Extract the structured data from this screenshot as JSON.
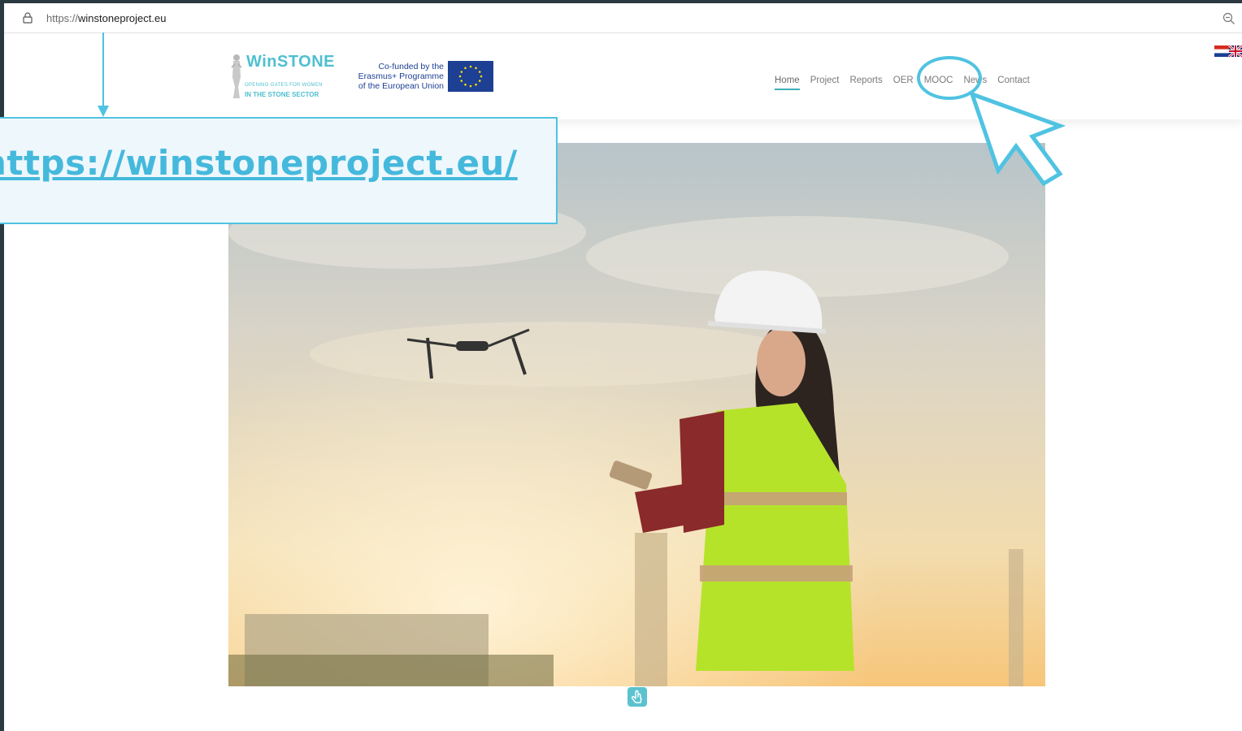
{
  "browser": {
    "url_scheme": "https://",
    "url_host": "winstoneproject.eu",
    "icons": {
      "lock": "lock-icon",
      "zoom": "zoom-out-icon"
    }
  },
  "site": {
    "logo": {
      "title": "WinSTONE",
      "subtitle_line1": "OPENING GATES FOR WOMEN",
      "subtitle_line2": "IN THE STONE SECTOR"
    },
    "eu_badge": {
      "line1": "Co-funded by the",
      "line2": "Erasmus+ Programme",
      "line3": "of the European Union"
    },
    "nav": [
      {
        "label": "Home",
        "active": true
      },
      {
        "label": "Project",
        "active": false
      },
      {
        "label": "Reports",
        "active": false
      },
      {
        "label": "OER",
        "active": false
      },
      {
        "label": "MOOC",
        "active": false
      },
      {
        "label": "News",
        "active": false
      },
      {
        "label": "Contact",
        "active": false
      }
    ],
    "language_icon": "language-flags-icon"
  },
  "overlay": {
    "callout_text": "https://winstoneproject.eu/"
  },
  "colors": {
    "accent": "#4fc3e1",
    "brand": "#4fbfcf",
    "eu_blue": "#1d3f94",
    "frame": "#2b3a40"
  }
}
